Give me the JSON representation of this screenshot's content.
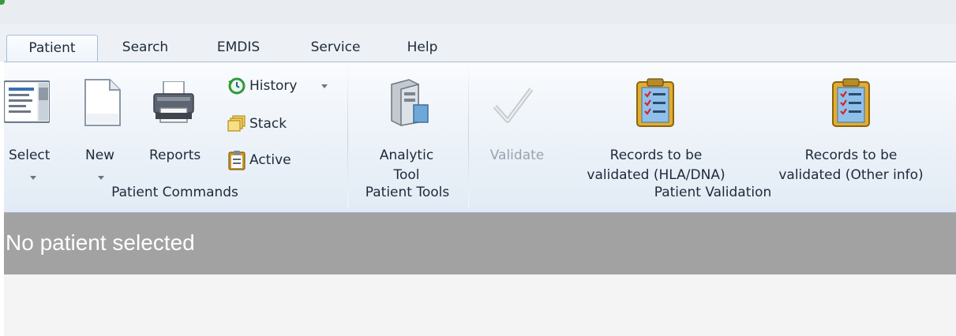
{
  "tabs": [
    {
      "label": "Patient",
      "active": true
    },
    {
      "label": "Search"
    },
    {
      "label": "EMDIS"
    },
    {
      "label": "Service"
    },
    {
      "label": "Help"
    }
  ],
  "groups": {
    "commands": {
      "label": "Patient Commands",
      "select": {
        "label": "Select",
        "icon": "list-window-icon"
      },
      "new": {
        "label": "New",
        "icon": "blank-document-icon"
      },
      "reports": {
        "label": "Reports",
        "icon": "printer-icon"
      },
      "history": {
        "label": "History",
        "icon": "history-clock-icon"
      },
      "stack": {
        "label": "Stack",
        "icon": "stack-folders-icon"
      },
      "active": {
        "label": "Active",
        "icon": "clipboard-icon"
      }
    },
    "tools": {
      "label": "Patient Tools",
      "analytic_line1": "Analytic",
      "analytic_line2": "Tool",
      "icon": "computer-tower-icon"
    },
    "validation": {
      "label": "Patient Validation",
      "validate": {
        "label": "Validate",
        "enabled": false,
        "icon": "checkmark-icon"
      },
      "hla": {
        "line1": "Records to be",
        "line2": "validated (HLA/DNA)",
        "icon": "checklist-clipboard-icon"
      },
      "other": {
        "line1": "Records to be",
        "line2": "validated (Other info)",
        "icon": "checklist-clipboard-icon"
      }
    }
  },
  "status": {
    "text": "No patient selected"
  },
  "colors": {
    "ribbon_border": "#a9bcd3",
    "status_bg": "#a2a2a2",
    "disabled_text": "#9aa3ad"
  }
}
